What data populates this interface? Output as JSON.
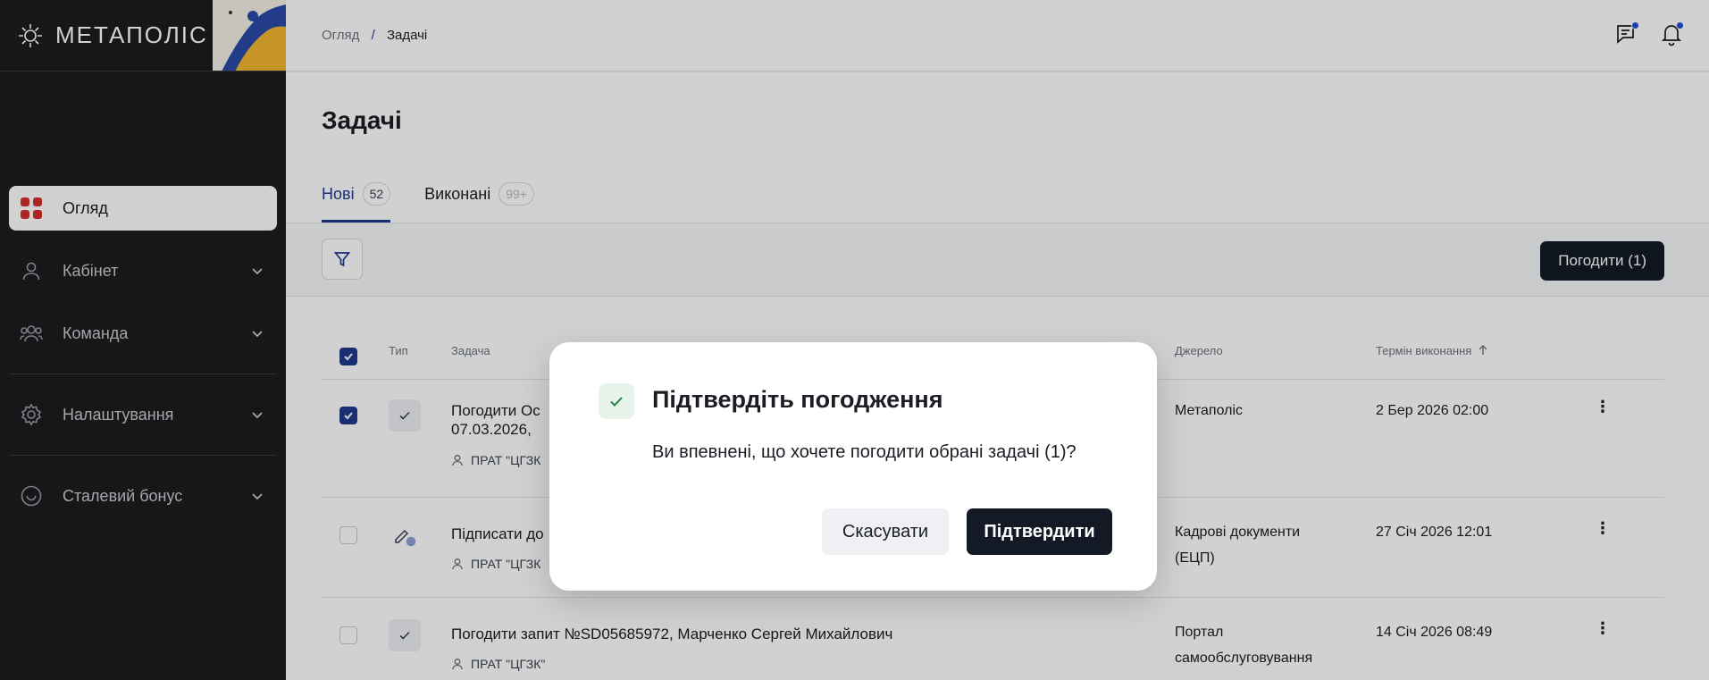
{
  "app": {
    "logo_text": "МЕТАПОЛІС"
  },
  "sidebar": {
    "items": [
      {
        "label": "Огляд"
      },
      {
        "label": "Кабінет"
      },
      {
        "label": "Команда"
      },
      {
        "label": "Налаштування"
      },
      {
        "label": "Сталевий бонус"
      }
    ]
  },
  "breadcrumb": {
    "root": "Огляд",
    "separator": "/",
    "current": "Задачі"
  },
  "page": {
    "title": "Задачі"
  },
  "tabs": [
    {
      "label": "Нові",
      "count": "52"
    },
    {
      "label": "Виконані",
      "count": "99+"
    }
  ],
  "toolbar": {
    "approve_label": "Погодити (1)"
  },
  "table": {
    "headers": {
      "type": "Тип",
      "task": "Задача",
      "source": "Джерело",
      "due": "Термін виконання"
    },
    "rows": [
      {
        "title_line1": "Погодити Ос",
        "title_line2": "07.03.2026,",
        "company": "ПРАТ \"ЦГЗК",
        "source": "Метаполіс",
        "due": "2 Бер 2026 02:00"
      },
      {
        "title_line1": "Підписати до",
        "company": "ПРАТ \"ЦГЗК",
        "source_line1": "Кадрові документи",
        "source_line2": "(ЕЦП)",
        "due": "27 Січ 2026 12:01"
      },
      {
        "title_line1": "Погодити запит №SD05685972, Марченко Сергей Михайлович",
        "company": "ПРАТ \"ЦГЗК\"",
        "source_line1": "Портал",
        "source_line2": "самообслуговування",
        "due": "14 Січ 2026 08:49"
      }
    ]
  },
  "modal": {
    "title": "Підтвердіть погодження",
    "text": "Ви впевнені, що хочете погодити обрані задачі (1)?",
    "cancel_label": "Скасувати",
    "confirm_label": "Підтвердити"
  },
  "colors": {
    "accent": "#1f3a8a",
    "dark_button": "#131a26",
    "sidebar_bg": "#1c1d1f",
    "active_icon": "#d32f2f",
    "notify_dot": "#1e4fd8"
  }
}
